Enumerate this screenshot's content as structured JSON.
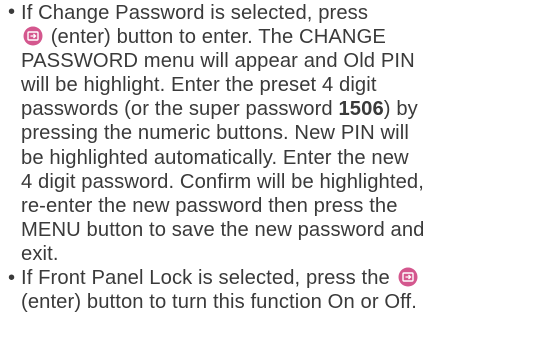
{
  "bullet_symbol": "•",
  "icon_color": "#d4578e",
  "items": [
    {
      "lines": [
        "If Change Password is selected, press",
        "(enter) button to enter. The CHANGE",
        "PASSWORD menu will appear and Old PIN",
        "will be highlight. Enter the preset 4 digit",
        "passwords (or the super password ",
        "1506",
        ") by",
        "pressing the numeric buttons. New PIN will",
        "be highlighted automatically. Enter the new",
        "4 digit password. Confirm will be highlighted,",
        "re-enter the new password then press the",
        "MENU button to save the new password and",
        "exit."
      ]
    },
    {
      "lines": [
        "If Front Panel Lock is selected, press the",
        "(enter) button to turn this function On or Off."
      ]
    }
  ]
}
